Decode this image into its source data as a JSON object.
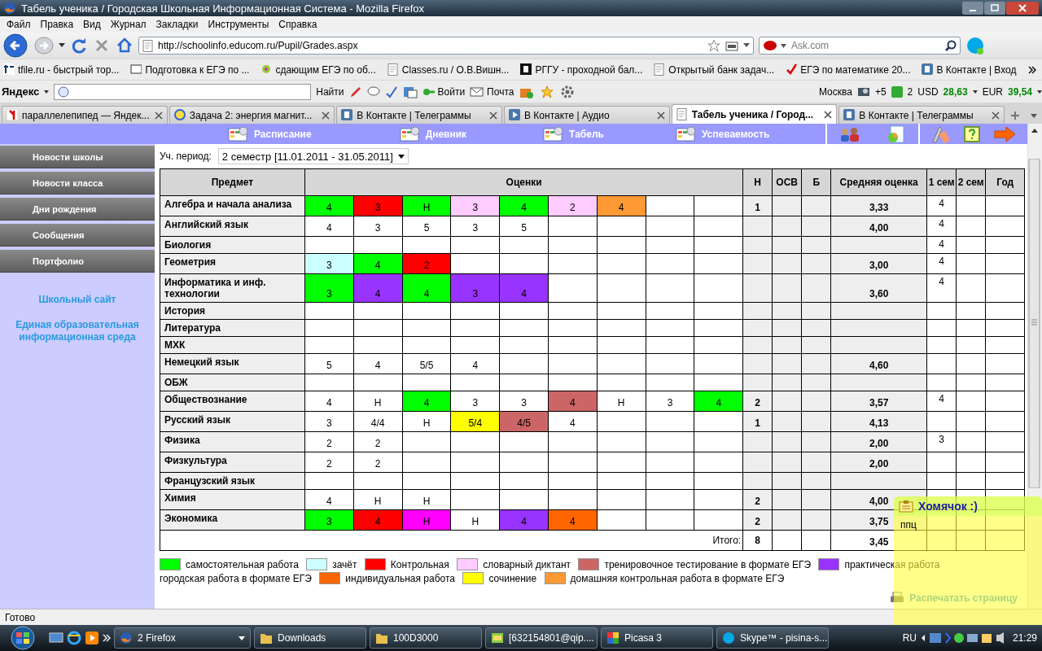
{
  "window": {
    "title": "Табель ученика / Городская Школьная Информационная Система - Mozilla Firefox"
  },
  "menu": [
    "Файл",
    "Правка",
    "Вид",
    "Журнал",
    "Закладки",
    "Инструменты",
    "Справка"
  ],
  "navigation": {
    "url": "http://schoolinfo.educom.ru/Pupil/Grades.aspx",
    "search_placeholder": "Ask.com"
  },
  "bookmarks": [
    "tfile.ru - быстрый тор...",
    "Подготовка к ЕГЭ по ...",
    "сдающим ЕГЭ по об...",
    "Classes.ru / О.В.Вишн...",
    "РГГУ - проходной бал...",
    "Открытый банк задач...",
    "ЕГЭ по математике 20...",
    "В Контакте | Вход"
  ],
  "yandex_bar": {
    "logo": "Яндекс",
    "search_button": "Найти",
    "login": "Войти",
    "mail": "Почта",
    "city": "Москва",
    "temperature": "+5",
    "messages": "2",
    "usd_label": "USD",
    "usd": "28,63",
    "eur_label": "EUR",
    "eur": "39,54"
  },
  "tabs": [
    {
      "label": "параллелепипед — Яндек...",
      "selected": false
    },
    {
      "label": "Задача 2: энергия магнит...",
      "selected": false
    },
    {
      "label": "В Контакте | Телеграммы",
      "selected": false
    },
    {
      "label": "В Контакте | Аудио",
      "selected": false
    },
    {
      "label": "Табель ученика / Город...",
      "selected": true
    },
    {
      "label": "В Контакте | Телеграммы",
      "selected": false
    }
  ],
  "site_nav": [
    "Расписание",
    "Дневник",
    "Табель",
    "Успеваемость"
  ],
  "sidebar": {
    "items": [
      "Новости школы",
      "Новости класса",
      "Дни рождения",
      "Сообщения",
      "Портфолио"
    ],
    "links": [
      "Школьный сайт",
      "Единая образовательная информационная среда"
    ]
  },
  "period": {
    "label": "Уч. период:",
    "value": "2 семестр [11.01.2011 - 31.05.2011]"
  },
  "table": {
    "columns": [
      "Предмет",
      "Оценки",
      "Н",
      "ОСВ",
      "Б",
      "Средняя оценка",
      "1 сем",
      "2 сем",
      "Год"
    ],
    "rows": [
      {
        "subject": "Алгебра и начала анализа",
        "grades": [
          {
            "value": "4",
            "color": "#00ff00"
          },
          {
            "value": "3",
            "color": "#ff0000"
          },
          {
            "value": "Н",
            "color": "#00ff00"
          },
          {
            "value": "3",
            "color": "#ffccff"
          },
          {
            "value": "4",
            "color": "#00ff00"
          },
          {
            "value": "2",
            "color": "#ffccff"
          },
          {
            "value": "4",
            "color": "#ff9933"
          }
        ],
        "absences": "1",
        "average": "3,33",
        "sem1": "4"
      },
      {
        "subject": "Английский язык",
        "grades": [
          {
            "value": "4"
          },
          {
            "value": "3"
          },
          {
            "value": "5"
          },
          {
            "value": "3"
          },
          {
            "value": "5"
          }
        ],
        "average": "4,00",
        "sem1": "4"
      },
      {
        "subject": "Биология",
        "grades": [],
        "sem1": "4"
      },
      {
        "subject": "Геометрия",
        "grades": [
          {
            "value": "3",
            "color": "#ccffff"
          },
          {
            "value": "4",
            "color": "#00ff00"
          },
          {
            "value": "2",
            "color": "#ff0000"
          }
        ],
        "average": "3,00",
        "sem1": "4"
      },
      {
        "subject": "Информатика и инф. технологии",
        "grades": [
          {
            "value": "3",
            "color": "#00ff00"
          },
          {
            "value": "4",
            "color": "#9933ff"
          },
          {
            "value": "4",
            "color": "#00ff00"
          },
          {
            "value": "3",
            "color": "#9933ff"
          },
          {
            "value": "4",
            "color": "#9933ff"
          }
        ],
        "average": "3,60",
        "sem1": "4"
      },
      {
        "subject": "История",
        "grades": []
      },
      {
        "subject": "Литература",
        "grades": []
      },
      {
        "subject": "МХК",
        "grades": []
      },
      {
        "subject": "Немецкий язык",
        "grades": [
          {
            "value": "5"
          },
          {
            "value": "4"
          },
          {
            "value": "5/5"
          },
          {
            "value": "4"
          }
        ],
        "average": "4,60"
      },
      {
        "subject": "ОБЖ",
        "grades": []
      },
      {
        "subject": "Обществознание",
        "grades": [
          {
            "value": "4"
          },
          {
            "value": "Н"
          },
          {
            "value": "4",
            "color": "#00ff00"
          },
          {
            "value": "3"
          },
          {
            "value": "3"
          },
          {
            "value": "4",
            "color": "#cc6666"
          },
          {
            "value": "Н"
          },
          {
            "value": "3"
          },
          {
            "value": "4",
            "color": "#00ff00"
          }
        ],
        "absences": "2",
        "average": "3,57",
        "sem1": "4"
      },
      {
        "subject": "Русский язык",
        "grades": [
          {
            "value": "3"
          },
          {
            "value": "4/4"
          },
          {
            "value": "Н"
          },
          {
            "value": "5/4",
            "color": "#ffff00"
          },
          {
            "value": "4/5",
            "color": "#cc6666"
          },
          {
            "value": "4"
          }
        ],
        "absences": "1",
        "average": "4,13"
      },
      {
        "subject": "Физика",
        "grades": [
          {
            "value": "2"
          },
          {
            "value": "2"
          }
        ],
        "average": "2,00",
        "sem1": "3"
      },
      {
        "subject": "Физкультура",
        "grades": [
          {
            "value": "2"
          },
          {
            "value": "2"
          }
        ],
        "average": "2,00"
      },
      {
        "subject": "Французский язык",
        "grades": []
      },
      {
        "subject": "Химия",
        "grades": [
          {
            "value": "4"
          },
          {
            "value": "Н"
          },
          {
            "value": "Н"
          }
        ],
        "absences": "2",
        "average": "4,00"
      },
      {
        "subject": "Экономика",
        "grades": [
          {
            "value": "3",
            "color": "#00ff00"
          },
          {
            "value": "4",
            "color": "#ff0000"
          },
          {
            "value": "Н",
            "color": "#ff00ff"
          },
          {
            "value": "Н"
          },
          {
            "value": "4",
            "color": "#9933ff"
          },
          {
            "value": "4",
            "color": "#ff6600"
          }
        ],
        "absences": "2",
        "average": "3,75"
      }
    ],
    "total": {
      "label": "Итого:",
      "absences": "8",
      "average": "3,45"
    }
  },
  "legend": [
    {
      "label": "самостоятельная работа",
      "color": "#00ff00"
    },
    {
      "label": "зачёт",
      "color": "#ccffff"
    },
    {
      "label": "Контрольная",
      "color": "#ff0000"
    },
    {
      "label": "словарный диктант",
      "color": "#ffccff"
    },
    {
      "label": "тренировочное тестирование в формате ЕГЭ",
      "color": "#cc6666"
    },
    {
      "label": "практическая работа",
      "color": "#9933ff"
    },
    {
      "label": "городская работа в формате ЕГЭ"
    },
    {
      "label": "индивидуальная работа",
      "color": "#ff6600"
    },
    {
      "label": "сочинение",
      "color": "#ffff00"
    },
    {
      "label": "домашняя контрольная работа в формате ЕГЭ",
      "color": "#ff9933"
    }
  ],
  "print_link": "Распечатать страницу",
  "notification": {
    "title": "Хомячок :)",
    "text": "ппц"
  },
  "status_bar": "Готово",
  "taskbar": {
    "buttons": [
      "2 Firefox",
      "Downloads",
      "100D3000",
      "[632154801@qip....",
      "Picasa 3",
      "Skype™ - pisina-s..."
    ],
    "language": "RU",
    "time": "21:29"
  }
}
